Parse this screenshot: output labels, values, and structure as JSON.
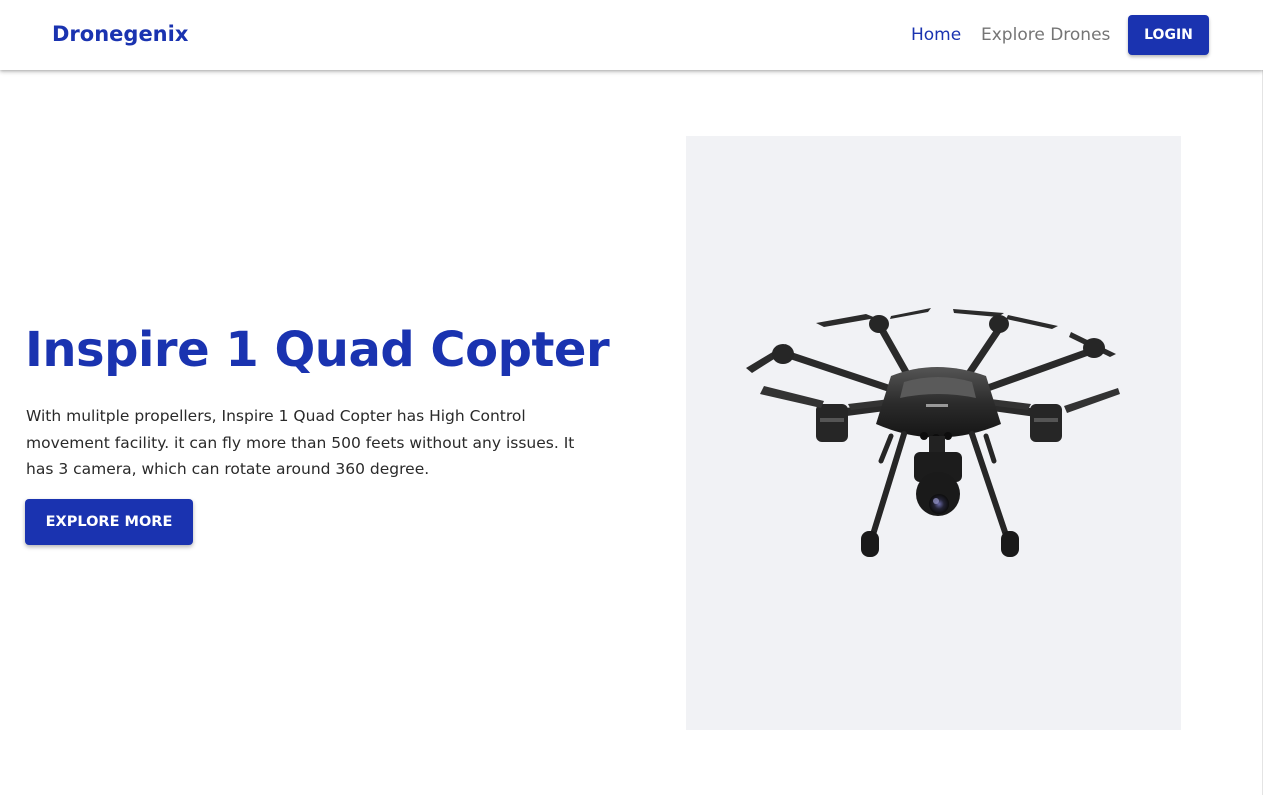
{
  "nav": {
    "brand": "Dronegenix",
    "links": [
      "Home",
      "Explore Drones"
    ],
    "login_label": "LOGIN"
  },
  "colors": {
    "brand": "#1a33b0",
    "muted_link": "#757575",
    "image_panel_bg": "#f1f2f5"
  },
  "hero": {
    "title": "Inspire 1 Quad Copter",
    "description": "With mulitple propellers, Inspire 1 Quad Copter has High Control movement facility. it can fly more than 500 feets without any issues. It has 3 camera, which can rotate around 360 degree.",
    "button_label": "EXPLORE MORE"
  }
}
